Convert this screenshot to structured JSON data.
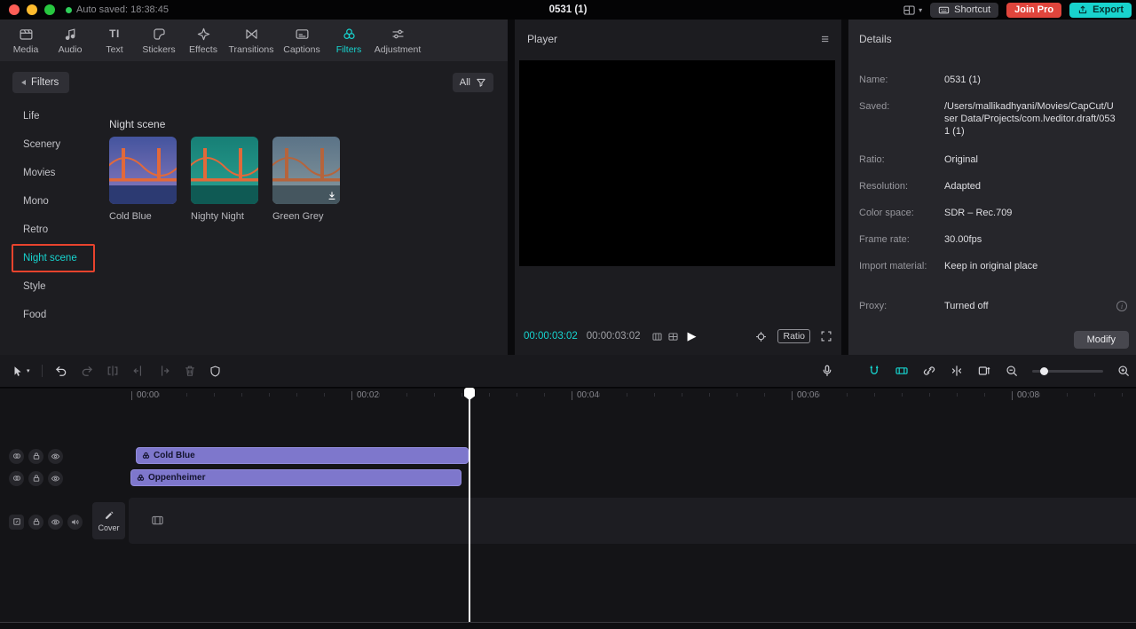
{
  "colors": {
    "accent": "#17d4cf",
    "join_pro_red": "#e0453c",
    "selection_red": "#e8432d",
    "clip_purple": "#7e77cc"
  },
  "titlebar": {
    "autosave": "Auto saved: 18:38:45",
    "title": "0531 (1)",
    "shortcut_label": "Shortcut",
    "join_pro_label": "Join Pro",
    "export_label": "Export"
  },
  "media_panel": {
    "tabs": [
      {
        "label": "Media"
      },
      {
        "label": "Audio"
      },
      {
        "label": "Text",
        "icon_text": "TI"
      },
      {
        "label": "Stickers"
      },
      {
        "label": "Effects"
      },
      {
        "label": "Transitions"
      },
      {
        "label": "Captions"
      },
      {
        "label": "Filters"
      },
      {
        "label": "Adjustment"
      }
    ],
    "active_tab": "Filters",
    "sidebar_header": "Filters",
    "sidebar_items": [
      {
        "label": "Life"
      },
      {
        "label": "Scenery"
      },
      {
        "label": "Movies"
      },
      {
        "label": "Mono"
      },
      {
        "label": "Retro"
      },
      {
        "label": "Night scene"
      },
      {
        "label": "Style"
      },
      {
        "label": "Food"
      }
    ],
    "selected_item": "Night scene",
    "section_title": "Night scene",
    "all_button_label": "All",
    "filter_cards": [
      {
        "name": "Cold Blue"
      },
      {
        "name": "Nighty Night"
      },
      {
        "name": "Green Grey",
        "downloadable": true
      }
    ]
  },
  "player": {
    "title": "Player",
    "current_time": "00:00:03:02",
    "total_time": "00:00:03:02",
    "ratio_label": "Ratio"
  },
  "details": {
    "title": "Details",
    "fields": [
      {
        "label": "Name:",
        "value": "0531 (1)"
      },
      {
        "label": "Saved:",
        "value": "/Users/mallikadhyani/Movies/CapCut/User Data/Projects/com.lveditor.draft/0531 (1)"
      },
      {
        "label": "Ratio:",
        "value": "Original"
      },
      {
        "label": "Resolution:",
        "value": "Adapted"
      },
      {
        "label": "Color space:",
        "value": "SDR – Rec.709"
      },
      {
        "label": "Frame rate:",
        "value": "30.00fps"
      },
      {
        "label": "Import material:",
        "value": "Keep in original place"
      },
      {
        "label": "Proxy:",
        "value": "Turned off"
      }
    ],
    "modify_label": "Modify"
  },
  "timeline": {
    "ruler_labels": [
      "00:00",
      "00:02",
      "00:04",
      "00:06",
      "00:08"
    ],
    "cover_label": "Cover",
    "clips": [
      {
        "name": "Cold Blue"
      },
      {
        "name": "Oppenheimer"
      }
    ],
    "playhead_time": "00:00:03:02"
  }
}
